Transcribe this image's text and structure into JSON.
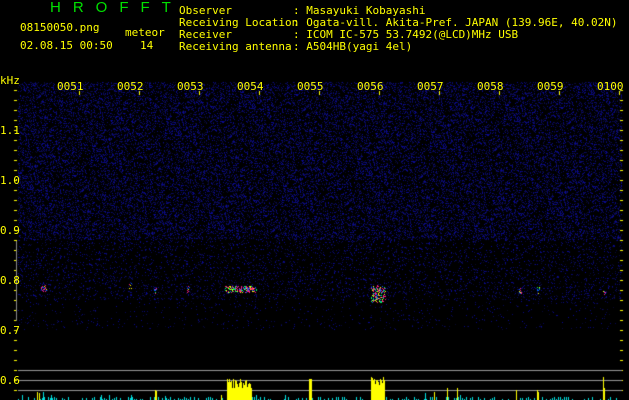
{
  "header": {
    "title": "HROFFT",
    "filename": "08150050.png",
    "datetime": "02.08.15 00:50",
    "meteor_label": "meteor",
    "meteor_count": "14"
  },
  "station": {
    "rows": [
      {
        "label": "Observer",
        "value": ": Masayuki Kobayashi"
      },
      {
        "label": "Receiving Location",
        "value": ": Ogata-vill. Akita-Pref. JAPAN (139.96E, 40.02N)"
      },
      {
        "label": "Receiver",
        "value": ": ICOM IC-575 53.7492(@LCD)MHz USB"
      },
      {
        "label": "Receiving antenna",
        "value": ": A504HB(yagi 4el)"
      }
    ]
  },
  "axis": {
    "unit": "kHz",
    "freq_labels": [
      "1.1",
      "1.0",
      "0.9",
      "0.8",
      "0.7",
      "0.6"
    ],
    "time_labels": [
      "0051",
      "0052",
      "0053",
      "0054",
      "0055",
      "0056",
      "0057",
      "0058",
      "0059",
      "0100"
    ]
  },
  "colors": {
    "text": "#ffff00",
    "title": "#00e000",
    "noise": "#1a1aa0",
    "bar_yellow": "#ffff00",
    "bar_cyan": "#00e0e0"
  }
}
